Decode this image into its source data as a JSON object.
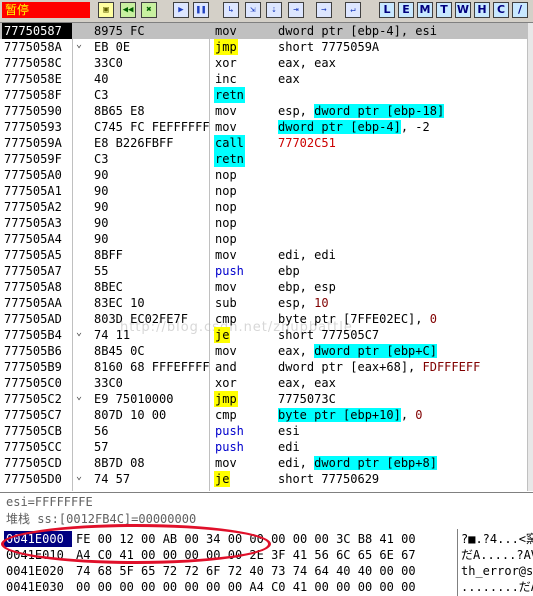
{
  "toolbar": {
    "status": "暂停",
    "buttons": [
      {
        "name": "open-icon",
        "glyph": "▣",
        "style": "yellow"
      },
      {
        "name": "restart-icon",
        "glyph": "◀◀",
        "style": "green"
      },
      {
        "name": "close-icon",
        "glyph": "✖",
        "style": "green"
      },
      {
        "name": "run-icon",
        "glyph": "▶",
        "style": "blue"
      },
      {
        "name": "pause-icon",
        "glyph": "❚❚",
        "style": "blue"
      },
      {
        "name": "step-into-icon",
        "glyph": "↳",
        "style": "blue"
      },
      {
        "name": "step-over-icon",
        "glyph": "⇲",
        "style": "blue"
      },
      {
        "name": "trace-into-icon",
        "glyph": "⇣",
        "style": "blue"
      },
      {
        "name": "trace-over-icon",
        "glyph": "⇥",
        "style": "blue"
      },
      {
        "name": "execute-till-return-icon",
        "glyph": "→",
        "style": "blue"
      },
      {
        "name": "goto-icon",
        "glyph": "↵",
        "style": "blue"
      }
    ],
    "windows": [
      "L",
      "E",
      "M",
      "T",
      "W",
      "H",
      "C",
      "/"
    ]
  },
  "disassembly": [
    {
      "addr": "77750587",
      "mark": "",
      "hex": "8975 FC",
      "mn": "mov",
      "mn_hl": "",
      "op": [
        {
          "t": "dword ptr [ebp-4], esi"
        }
      ],
      "selected": true
    },
    {
      "addr": "7775058A",
      "mark": "⌄",
      "hex": "EB 0E",
      "mn": "jmp",
      "mn_hl": "y",
      "op": [
        {
          "t": "short 7775059A"
        }
      ]
    },
    {
      "addr": "7775058C",
      "mark": "",
      "hex": "33C0",
      "mn": "xor",
      "mn_hl": "",
      "op": [
        {
          "t": "eax, eax"
        }
      ]
    },
    {
      "addr": "7775058E",
      "mark": "",
      "hex": "40",
      "mn": "inc",
      "mn_hl": "",
      "op": [
        {
          "t": "eax"
        }
      ]
    },
    {
      "addr": "7775058F",
      "mark": "",
      "hex": "C3",
      "mn": "retn",
      "mn_hl": "c",
      "op": [
        {
          "t": ""
        }
      ]
    },
    {
      "addr": "77750590",
      "mark": "",
      "hex": "8B65 E8",
      "mn": "mov",
      "mn_hl": "",
      "op": [
        {
          "t": "esp, "
        },
        {
          "t": "dword ptr [ebp-18]",
          "c": "hl-c"
        }
      ]
    },
    {
      "addr": "77750593",
      "mark": "",
      "hex": "C745 FC FEFFFFFF",
      "mn": "mov",
      "mn_hl": "",
      "op": [
        {
          "t": "dword ptr [ebp-4]",
          "c": "hl-c"
        },
        {
          "t": ", -2"
        }
      ]
    },
    {
      "addr": "7775059A",
      "mark": "",
      "hex": "E8 B226FBFF",
      "mn": "call",
      "mn_hl": "c",
      "op": [
        {
          "t": "77702C51",
          "c": "red"
        }
      ]
    },
    {
      "addr": "7775059F",
      "mark": "",
      "hex": "C3",
      "mn": "retn",
      "mn_hl": "c",
      "op": [
        {
          "t": ""
        }
      ]
    },
    {
      "addr": "777505A0",
      "mark": "",
      "hex": "90",
      "mn": "nop",
      "mn_hl": "",
      "op": [
        {
          "t": ""
        }
      ]
    },
    {
      "addr": "777505A1",
      "mark": "",
      "hex": "90",
      "mn": "nop",
      "mn_hl": "",
      "op": [
        {
          "t": ""
        }
      ]
    },
    {
      "addr": "777505A2",
      "mark": "",
      "hex": "90",
      "mn": "nop",
      "mn_hl": "",
      "op": [
        {
          "t": ""
        }
      ]
    },
    {
      "addr": "777505A3",
      "mark": "",
      "hex": "90",
      "mn": "nop",
      "mn_hl": "",
      "op": [
        {
          "t": ""
        }
      ]
    },
    {
      "addr": "777505A4",
      "mark": "",
      "hex": "90",
      "mn": "nop",
      "mn_hl": "",
      "op": [
        {
          "t": ""
        }
      ]
    },
    {
      "addr": "777505A5",
      "mark": "",
      "hex": "8BFF",
      "mn": "mov",
      "mn_hl": "",
      "op": [
        {
          "t": "edi, edi"
        }
      ]
    },
    {
      "addr": "777505A7",
      "mark": "",
      "hex": "55",
      "mn": "push",
      "mn_hl": "",
      "mn_c": "blue",
      "op": [
        {
          "t": "ebp"
        }
      ]
    },
    {
      "addr": "777505A8",
      "mark": "",
      "hex": "8BEC",
      "mn": "mov",
      "mn_hl": "",
      "op": [
        {
          "t": "ebp, esp"
        }
      ]
    },
    {
      "addr": "777505AA",
      "mark": "",
      "hex": "83EC 10",
      "mn": "sub",
      "mn_hl": "",
      "op": [
        {
          "t": "esp, "
        },
        {
          "t": "10",
          "c": "num"
        }
      ]
    },
    {
      "addr": "777505AD",
      "mark": "",
      "hex": "803D EC02FE7F",
      "mn": "cmp",
      "mn_hl": "",
      "op": [
        {
          "t": "byte ptr [7FFE02EC], "
        },
        {
          "t": "0",
          "c": "num"
        }
      ]
    },
    {
      "addr": "777505B4",
      "mark": "⌄",
      "hex": "74 11",
      "mn": "je",
      "mn_hl": "y",
      "op": [
        {
          "t": "short 777505C7"
        }
      ]
    },
    {
      "addr": "777505B6",
      "mark": "",
      "hex": "8B45 0C",
      "mn": "mov",
      "mn_hl": "",
      "op": [
        {
          "t": "eax, "
        },
        {
          "t": "dword ptr [ebp+C]",
          "c": "hl-c"
        }
      ]
    },
    {
      "addr": "777505B9",
      "mark": "",
      "hex": "8160 68 FFFEFFFF",
      "mn": "and",
      "mn_hl": "",
      "op": [
        {
          "t": "dword ptr [eax+68], "
        },
        {
          "t": "FDFFFEFF",
          "c": "num"
        }
      ]
    },
    {
      "addr": "777505C0",
      "mark": "",
      "hex": "33C0",
      "mn": "xor",
      "mn_hl": "",
      "op": [
        {
          "t": "eax, eax"
        }
      ]
    },
    {
      "addr": "777505C2",
      "mark": "⌄",
      "hex": "E9 75010000",
      "mn": "jmp",
      "mn_hl": "y",
      "op": [
        {
          "t": "7775073C"
        }
      ]
    },
    {
      "addr": "777505C7",
      "mark": "",
      "hex": "807D 10 00",
      "mn": "cmp",
      "mn_hl": "",
      "op": [
        {
          "t": "byte ptr [ebp+10]",
          "c": "hl-c"
        },
        {
          "t": ", "
        },
        {
          "t": "0",
          "c": "num"
        }
      ]
    },
    {
      "addr": "777505CB",
      "mark": "",
      "hex": "56",
      "mn": "push",
      "mn_hl": "",
      "mn_c": "blue",
      "op": [
        {
          "t": "esi"
        }
      ]
    },
    {
      "addr": "777505CC",
      "mark": "",
      "hex": "57",
      "mn": "push",
      "mn_hl": "",
      "mn_c": "blue",
      "op": [
        {
          "t": "edi"
        }
      ]
    },
    {
      "addr": "777505CD",
      "mark": "",
      "hex": "8B7D 08",
      "mn": "mov",
      "mn_hl": "",
      "op": [
        {
          "t": "edi, "
        },
        {
          "t": "dword ptr [ebp+8]",
          "c": "hl-c"
        }
      ]
    },
    {
      "addr": "777505D0",
      "mark": "⌄",
      "hex": "74 57",
      "mn": "je",
      "mn_hl": "y",
      "op": [
        {
          "t": "short 77750629"
        }
      ]
    }
  ],
  "watermark": "http://blog.csdn.net/zhupbattle",
  "info": {
    "line1": "esi=FFFFFFFE",
    "line2": "堆栈 ss:[0012FB4C]=00000000"
  },
  "dump": [
    {
      "addr": "0041E000",
      "hex": "FE 00 12 00 AB 00 34 00 00 00 00 00 3C B8 41 00",
      "ascii": "?■.?4...<窯A.",
      "selected": true
    },
    {
      "addr": "0041E010",
      "hex": "A4 C0 41 00 00 00 00 00 2E 3F 41 56 6C 65 6E 67",
      "ascii": "だA.....?AVleng"
    },
    {
      "addr": "0041E020",
      "hex": "74 68 5F 65 72 72 6F 72 40 73 74 64 40 40 00 00",
      "ascii": "th_error@std@@.."
    },
    {
      "addr": "0041E030",
      "hex": "00 00 00 00 00 00 00 00 A4 C0 41 00 00 00 00 00",
      "ascii": "........だA....."
    }
  ]
}
